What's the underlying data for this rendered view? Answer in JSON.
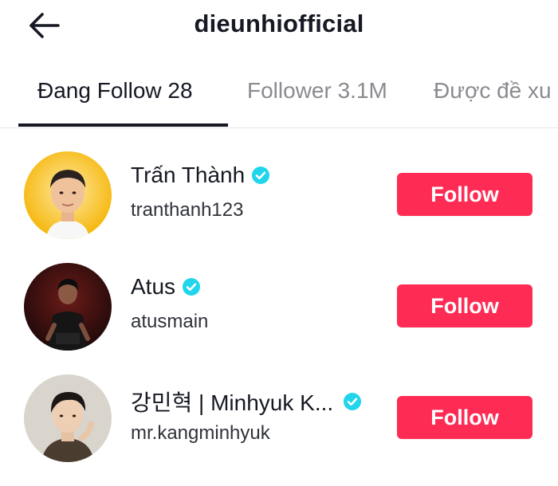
{
  "header": {
    "back_icon": "arrow-left-icon",
    "title": "dieunhiofficial"
  },
  "tabs": [
    {
      "label": "Đang Follow 28",
      "active": true
    },
    {
      "label": "Follower 3.1M",
      "active": false
    },
    {
      "label": "Được đề xu",
      "active": false
    }
  ],
  "users": [
    {
      "name": "Trấn Thành",
      "handle": "tranthanh123",
      "verified": true,
      "button": "Follow",
      "avatar": "avatar-photo"
    },
    {
      "name": "Atus",
      "handle": "atusmain",
      "verified": true,
      "button": "Follow",
      "avatar": "avatar-photo"
    },
    {
      "name": "강민혁 | Minhyuk K...",
      "handle": "mr.kangminhyuk",
      "verified": true,
      "button": "Follow",
      "avatar": "avatar-photo"
    }
  ],
  "colors": {
    "accent": "#fe2c55",
    "verified": "#20d5ec",
    "text": "#161823",
    "muted": "#8a8b91"
  }
}
